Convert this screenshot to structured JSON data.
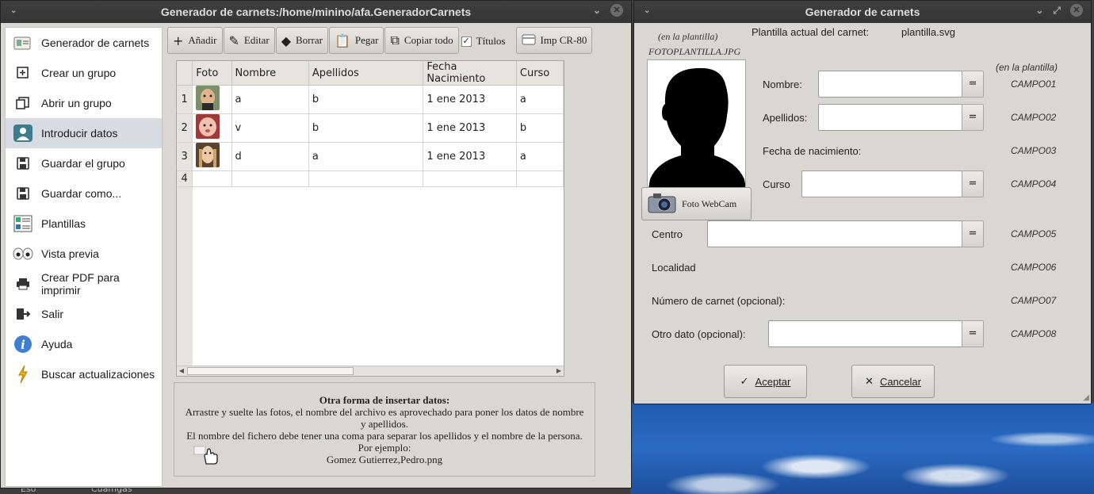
{
  "main_window": {
    "title": "Generador de carnets:/home/minino/afa.GeneradorCarnets",
    "sidebar": [
      {
        "label": "Generador de carnets",
        "icon": "app-logo-icon"
      },
      {
        "label": "Crear un grupo",
        "icon": "new-group-icon"
      },
      {
        "label": "Abrir un grupo",
        "icon": "open-group-icon"
      },
      {
        "label": "Introducir datos",
        "icon": "user-data-icon",
        "active": true
      },
      {
        "label": "Guardar el grupo",
        "icon": "save-icon"
      },
      {
        "label": "Guardar como...",
        "icon": "save-as-icon"
      },
      {
        "label": "Plantillas",
        "icon": "templates-icon"
      },
      {
        "label": "Vista previa",
        "icon": "preview-eyes-icon"
      },
      {
        "label": "Crear PDF para imprimir",
        "icon": "printer-icon"
      },
      {
        "label": "Salir",
        "icon": "exit-icon"
      },
      {
        "label": "Ayuda",
        "icon": "info-icon"
      },
      {
        "label": "Buscar actualizaciones",
        "icon": "lightning-icon"
      }
    ],
    "toolbar": {
      "add": "Añadir",
      "edit": "Editar",
      "delete": "Borrar",
      "paste": "Pegar",
      "copy_all": "Copiar todo",
      "titles": "Títulos",
      "titles_checked": true,
      "print_card": "Imp CR-80"
    },
    "table": {
      "columns": [
        "Foto",
        "Nombre",
        "Apellidos",
        "Fecha Nacimiento",
        "Curso"
      ],
      "rows": [
        {
          "n": "1",
          "nombre": "a",
          "apellidos": "b",
          "fecha": "1 ene 2013",
          "curso": "a"
        },
        {
          "n": "2",
          "nombre": "v",
          "apellidos": "b",
          "fecha": "1 ene 2013",
          "curso": "b"
        },
        {
          "n": "3",
          "nombre": "d",
          "apellidos": "a",
          "fecha": "1 ene 2013",
          "curso": "a"
        },
        {
          "n": "4",
          "nombre": "",
          "apellidos": "",
          "fecha": "",
          "curso": ""
        }
      ]
    },
    "hint": {
      "title": "Otra forma de insertar datos:",
      "line1": "Arrastre y suelte las fotos, el nombre del archivo es aprovechado para poner los datos de nombre y apellidos.",
      "line2": "El nombre del fichero debe tener una coma para separar los apellidos y el nombre de la persona.",
      "line3": "Por ejemplo:",
      "line4": "Gomez Gutierrez,Pedro.png"
    }
  },
  "dialog": {
    "title": "Generador de carnets",
    "photo_caption": "(en la plantilla)",
    "photo_field": "FOTOPLANTILLA.JPG",
    "template_label": "Plantilla actual del carnet:",
    "template_value": "plantilla.svg",
    "in_template": "(en la plantilla)",
    "webcam_button": "Foto WebCam",
    "fields": {
      "nombre": {
        "label": "Nombre:",
        "campo": "CAMPO01",
        "value": ""
      },
      "apellidos": {
        "label": "Apellidos:",
        "campo": "CAMPO02",
        "value": ""
      },
      "fecha": {
        "label": "Fecha de nacimiento:",
        "campo": "CAMPO03"
      },
      "curso": {
        "label": "Curso",
        "campo": "CAMPO04",
        "value": ""
      },
      "centro": {
        "label": "Centro",
        "campo": "CAMPO05",
        "value": ""
      },
      "localidad": {
        "label": "Localidad",
        "campo": "CAMPO06"
      },
      "numero": {
        "label": "Número de carnet (opcional):",
        "campo": "CAMPO07"
      },
      "otro": {
        "label": "Otro dato (opcional):",
        "campo": "CAMPO08",
        "value": ""
      }
    },
    "eq_label": "=",
    "accept": "Aceptar",
    "cancel": "Cancelar"
  },
  "taskbar": {
    "item1": "Eso",
    "item2": "Cuamgas"
  }
}
